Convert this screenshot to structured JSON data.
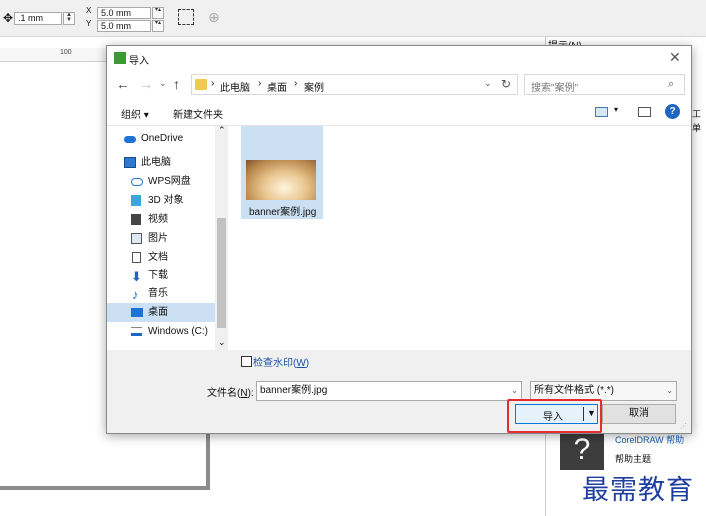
{
  "toolbar": {
    "nudge_value": ".1 mm",
    "dup_x_value": "5.0 mm",
    "dup_y_value": "5.0 mm",
    "x_label": "X",
    "y_label": "Y"
  },
  "ruler": {
    "tick_label": "100"
  },
  "right_panel": {
    "title": "提示(N)",
    "help_link": "CorelDRAW 帮助",
    "help_topics": "帮助主题",
    "edge_text_1": "工",
    "edge_text_2": "单"
  },
  "watermark": "最需教育",
  "dialog": {
    "title": "导入",
    "breadcrumb": [
      "此电脑",
      "桌面",
      "案例"
    ],
    "search_placeholder": "搜索\"案例\"",
    "organize_label": "组织 ▾",
    "new_folder_label": "新建文件夹",
    "nav_items": [
      {
        "label": "OneDrive",
        "icon": "cloud-icon"
      },
      {
        "label": "此电脑",
        "icon": "computer-icon"
      },
      {
        "label": "WPS网盘",
        "icon": "cloud-drive-icon"
      },
      {
        "label": "3D 对象",
        "icon": "cube-icon"
      },
      {
        "label": "视频",
        "icon": "video-icon"
      },
      {
        "label": "图片",
        "icon": "picture-icon"
      },
      {
        "label": "文档",
        "icon": "document-icon"
      },
      {
        "label": "下载",
        "icon": "download-icon"
      },
      {
        "label": "音乐",
        "icon": "music-icon"
      },
      {
        "label": "桌面",
        "icon": "desktop-icon",
        "selected": true
      },
      {
        "label": "Windows (C:)",
        "icon": "drive-icon"
      }
    ],
    "file": {
      "name": "banner案例.jpg"
    },
    "check_watermark_label": "检查水印(",
    "check_watermark_key": "W",
    "filename_label": "文件名(",
    "filename_key": "N",
    "filename_value": "banner案例.jpg",
    "filetype_value": "所有文件格式 (*.*)",
    "import_label": "导入",
    "cancel_label": "取消"
  },
  "colors": {
    "accent": "#0078d7",
    "highlight_box": "#e52d2d",
    "watermark": "#1f3fa0"
  }
}
